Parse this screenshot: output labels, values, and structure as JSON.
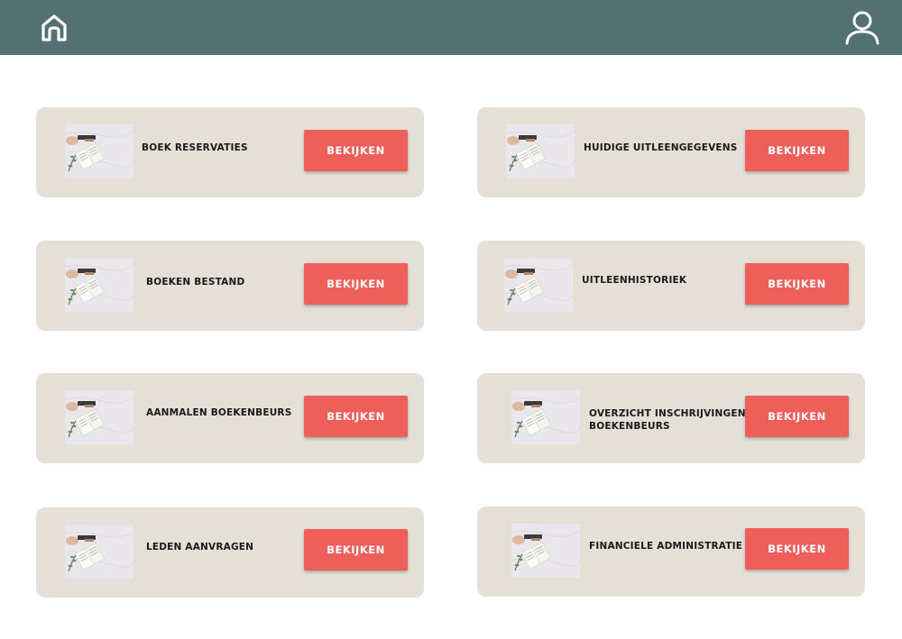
{
  "header": {
    "home_icon": "home-icon",
    "user_icon": "user-icon",
    "background_color": "#537072"
  },
  "colors": {
    "card_background": "#e4e0d8",
    "button_background": "#ef5f5a",
    "button_text": "#ffffff"
  },
  "cards": [
    {
      "label": "BOEK RESERVATIES",
      "button": "BEKIJKEN"
    },
    {
      "label": "HUIDIGE UITLEENGEGEVENS",
      "button": "BEKIJKEN"
    },
    {
      "label": "BOEKEN BESTAND",
      "button": "BEKIJKEN"
    },
    {
      "label": "UITLEENHISTORIEK",
      "button": "BEKIJKEN"
    },
    {
      "label": "AANMALEN BOEKENBEURS",
      "button": "BEKIJKEN"
    },
    {
      "label": "OVERZICHT INSCHRIJVINGEN BOEKENBEURS",
      "button": "BEKIJKEN"
    },
    {
      "label": "LEDEN AANVRAGEN",
      "button": "BEKIJKEN"
    },
    {
      "label": "FINANCIELE ADMINISTRATIE",
      "button": "BEKIJKEN"
    }
  ]
}
